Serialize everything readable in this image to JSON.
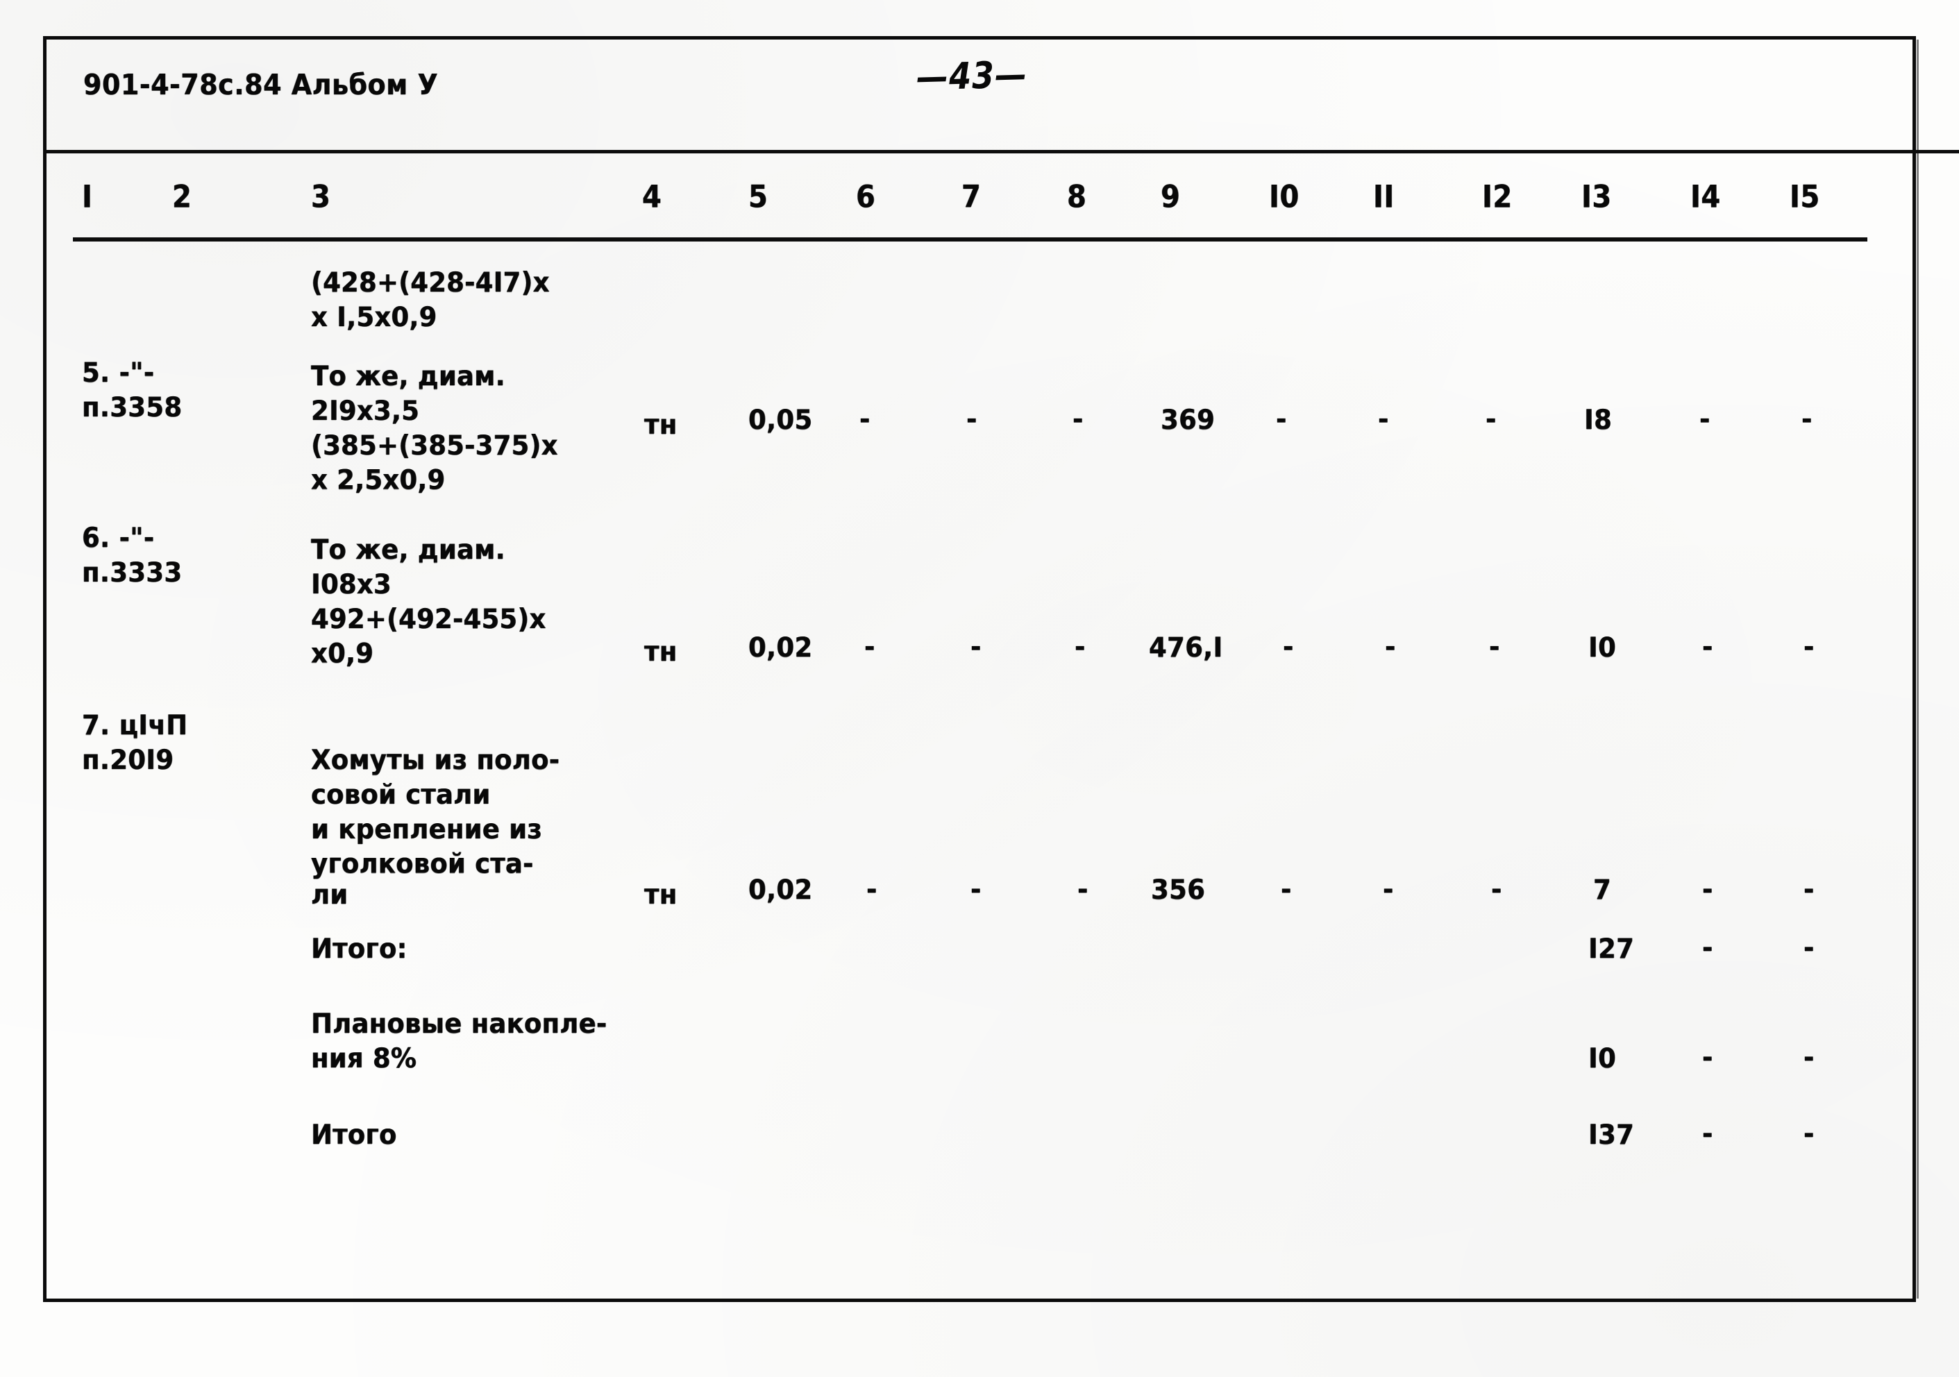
{
  "document": {
    "album_code": "901-4-78с.84 Альбом У",
    "page_number": "—43—"
  },
  "table": {
    "column_numbers": [
      "I",
      "2",
      "3",
      "4",
      "5",
      "6",
      "7",
      "8",
      "9",
      "I0",
      "II",
      "I2",
      "I3",
      "I4",
      "I5"
    ],
    "rows": [
      {
        "id": "row-continuation",
        "col1": "",
        "col3": "(428+(428-4I7)х\nх I,5х0,9",
        "col4": "",
        "col5": "",
        "col9": "",
        "col13": ""
      },
      {
        "id": "row-5",
        "col1": "5.  -\"-\nп.3358",
        "col3": "То же, диам.\n2I9х3,5\n(385+(385-375)х\nх 2,5х0,9",
        "col4": "тн",
        "col5": "0,05",
        "col6": "-",
        "col7": "-",
        "col8": "-",
        "col9": "369",
        "col10": "-",
        "col11": "-",
        "col12": "-",
        "col13": "I8",
        "col14": "-",
        "col15": "-"
      },
      {
        "id": "row-6",
        "col1": "6.  -\"-\n   п.3333",
        "col3": "То же, диам.\nI08х3\n492+(492-455)х\nх0,9",
        "col4": "тн",
        "col5": "0,02",
        "col6": "-",
        "col7": "-",
        "col8": "-",
        "col9": "476,I",
        "col10": "-",
        "col11": "-",
        "col12": "-",
        "col13": "I0",
        "col14": "-",
        "col15": "-"
      },
      {
        "id": "row-7",
        "col1": "7. цIчП\n   п.20I9",
        "col3": "Хомуты из поло-\nсовой стали\nи крепление из\nуголковой ста-",
        "col3b": "ли",
        "col4": "тн",
        "col5": "0,02",
        "col6": "-",
        "col7": "-",
        "col8": "-",
        "col9": "356",
        "col10": "-",
        "col11": "-",
        "col12": "-",
        "col13": "7",
        "col14": "-",
        "col15": "-"
      },
      {
        "id": "row-subtotal",
        "col3": "Итого:",
        "col13": "I27",
        "col14": "-",
        "col15": "-"
      },
      {
        "id": "row-overhead",
        "col3": "Плановые накопле-\nния 8%",
        "col13": "I0",
        "col14": "-",
        "col15": "-"
      },
      {
        "id": "row-total",
        "col3": "Итого",
        "col13": "I37",
        "col14": "-",
        "col15": "-"
      }
    ]
  }
}
